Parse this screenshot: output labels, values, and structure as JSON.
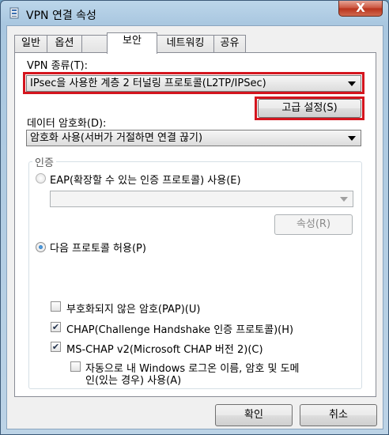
{
  "window": {
    "title": "VPN 연결 속성",
    "icon": "vpn-network-icon",
    "close_label": "X"
  },
  "tabs": [
    {
      "label": "일반",
      "active": false
    },
    {
      "label": "옵션",
      "active": false
    },
    {
      "label": "보안",
      "active": true
    },
    {
      "label": "네트워킹",
      "active": false
    },
    {
      "label": "공유",
      "active": false
    }
  ],
  "security": {
    "vpn_type_label": "VPN 종류(T):",
    "vpn_type_value": "IPsec을 사용한 계층 2 터널링 프로토콜(L2TP/IPSec)",
    "advanced_button": "고급 설정(S)",
    "encryption_label": "데이터 암호화(D):",
    "encryption_value": "암호화 사용(서버가 거절하면 연결 끊기)",
    "auth_group_title": "인증",
    "eap_radio_label": "EAP(확장할 수 있는 인증 프로토콜) 사용(E)",
    "eap_combo_value": "",
    "properties_button": "속성(R)",
    "allow_protocols_label": "다음 프로토콜 허용(P)",
    "pap_label": "부호화되지 않은 암호(PAP)(U)",
    "pap_checked": false,
    "chap_label": "CHAP(Challenge Handshake 인증 프로토콜)(H)",
    "chap_checked": true,
    "mschap_label": "MS-CHAP v2(Microsoft CHAP 버전 2)(C)",
    "mschap_checked": true,
    "autologon_label_line1": "자동으로 내 Windows 로그온 이름, 암호 및 도메",
    "autologon_label_line2": "인(있는 경우) 사용(A)",
    "autologon_checked": false
  },
  "footer": {
    "ok_button": "확인",
    "cancel_button": "취소"
  },
  "colors": {
    "highlight_border": "#d4151e",
    "titlebar": "#a9c7e0",
    "close_button": "#c9503a"
  }
}
